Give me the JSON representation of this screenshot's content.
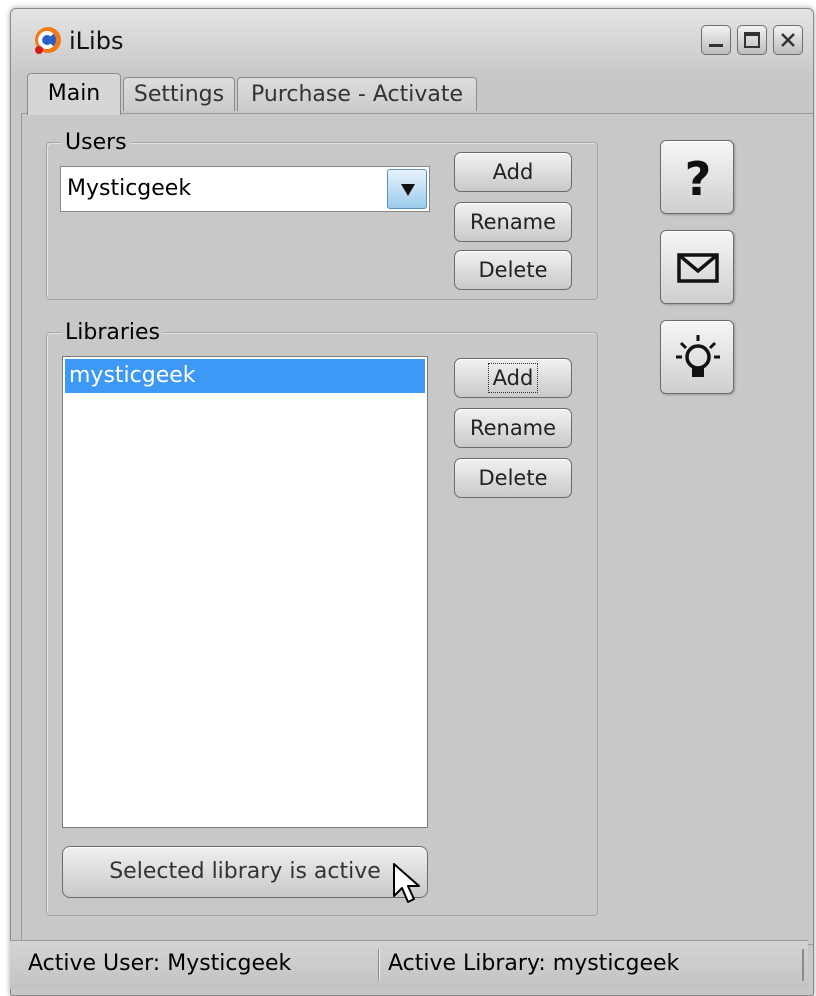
{
  "window": {
    "title": "iLibs",
    "controls": {
      "minimize": "minimize-icon",
      "maximize": "maximize-icon",
      "close": "close-icon"
    }
  },
  "tabs": [
    {
      "label": "Main",
      "active": true
    },
    {
      "label": "Settings",
      "active": false
    },
    {
      "label": "Purchase - Activate",
      "active": false
    }
  ],
  "users": {
    "legend": "Users",
    "selected": "Mysticgeek",
    "buttons": {
      "add": "Add",
      "rename": "Rename",
      "delete": "Delete"
    }
  },
  "libraries": {
    "legend": "Libraries",
    "items": [
      "mysticgeek"
    ],
    "selected_index": 0,
    "buttons": {
      "add": "Add",
      "rename": "Rename",
      "delete": "Delete"
    },
    "activate_button": "Selected library is active"
  },
  "side_buttons": [
    {
      "icon": "help-question-icon"
    },
    {
      "icon": "mail-envelope-icon"
    },
    {
      "icon": "lightbulb-idea-icon"
    }
  ],
  "status": {
    "active_user": "Active User: Mysticgeek",
    "active_library": "Active Library: mysticgeek"
  },
  "colors": {
    "window_bg": "#c7c7c7",
    "selection": "#3d99f5",
    "combo_arrow": "#9ccbee"
  }
}
